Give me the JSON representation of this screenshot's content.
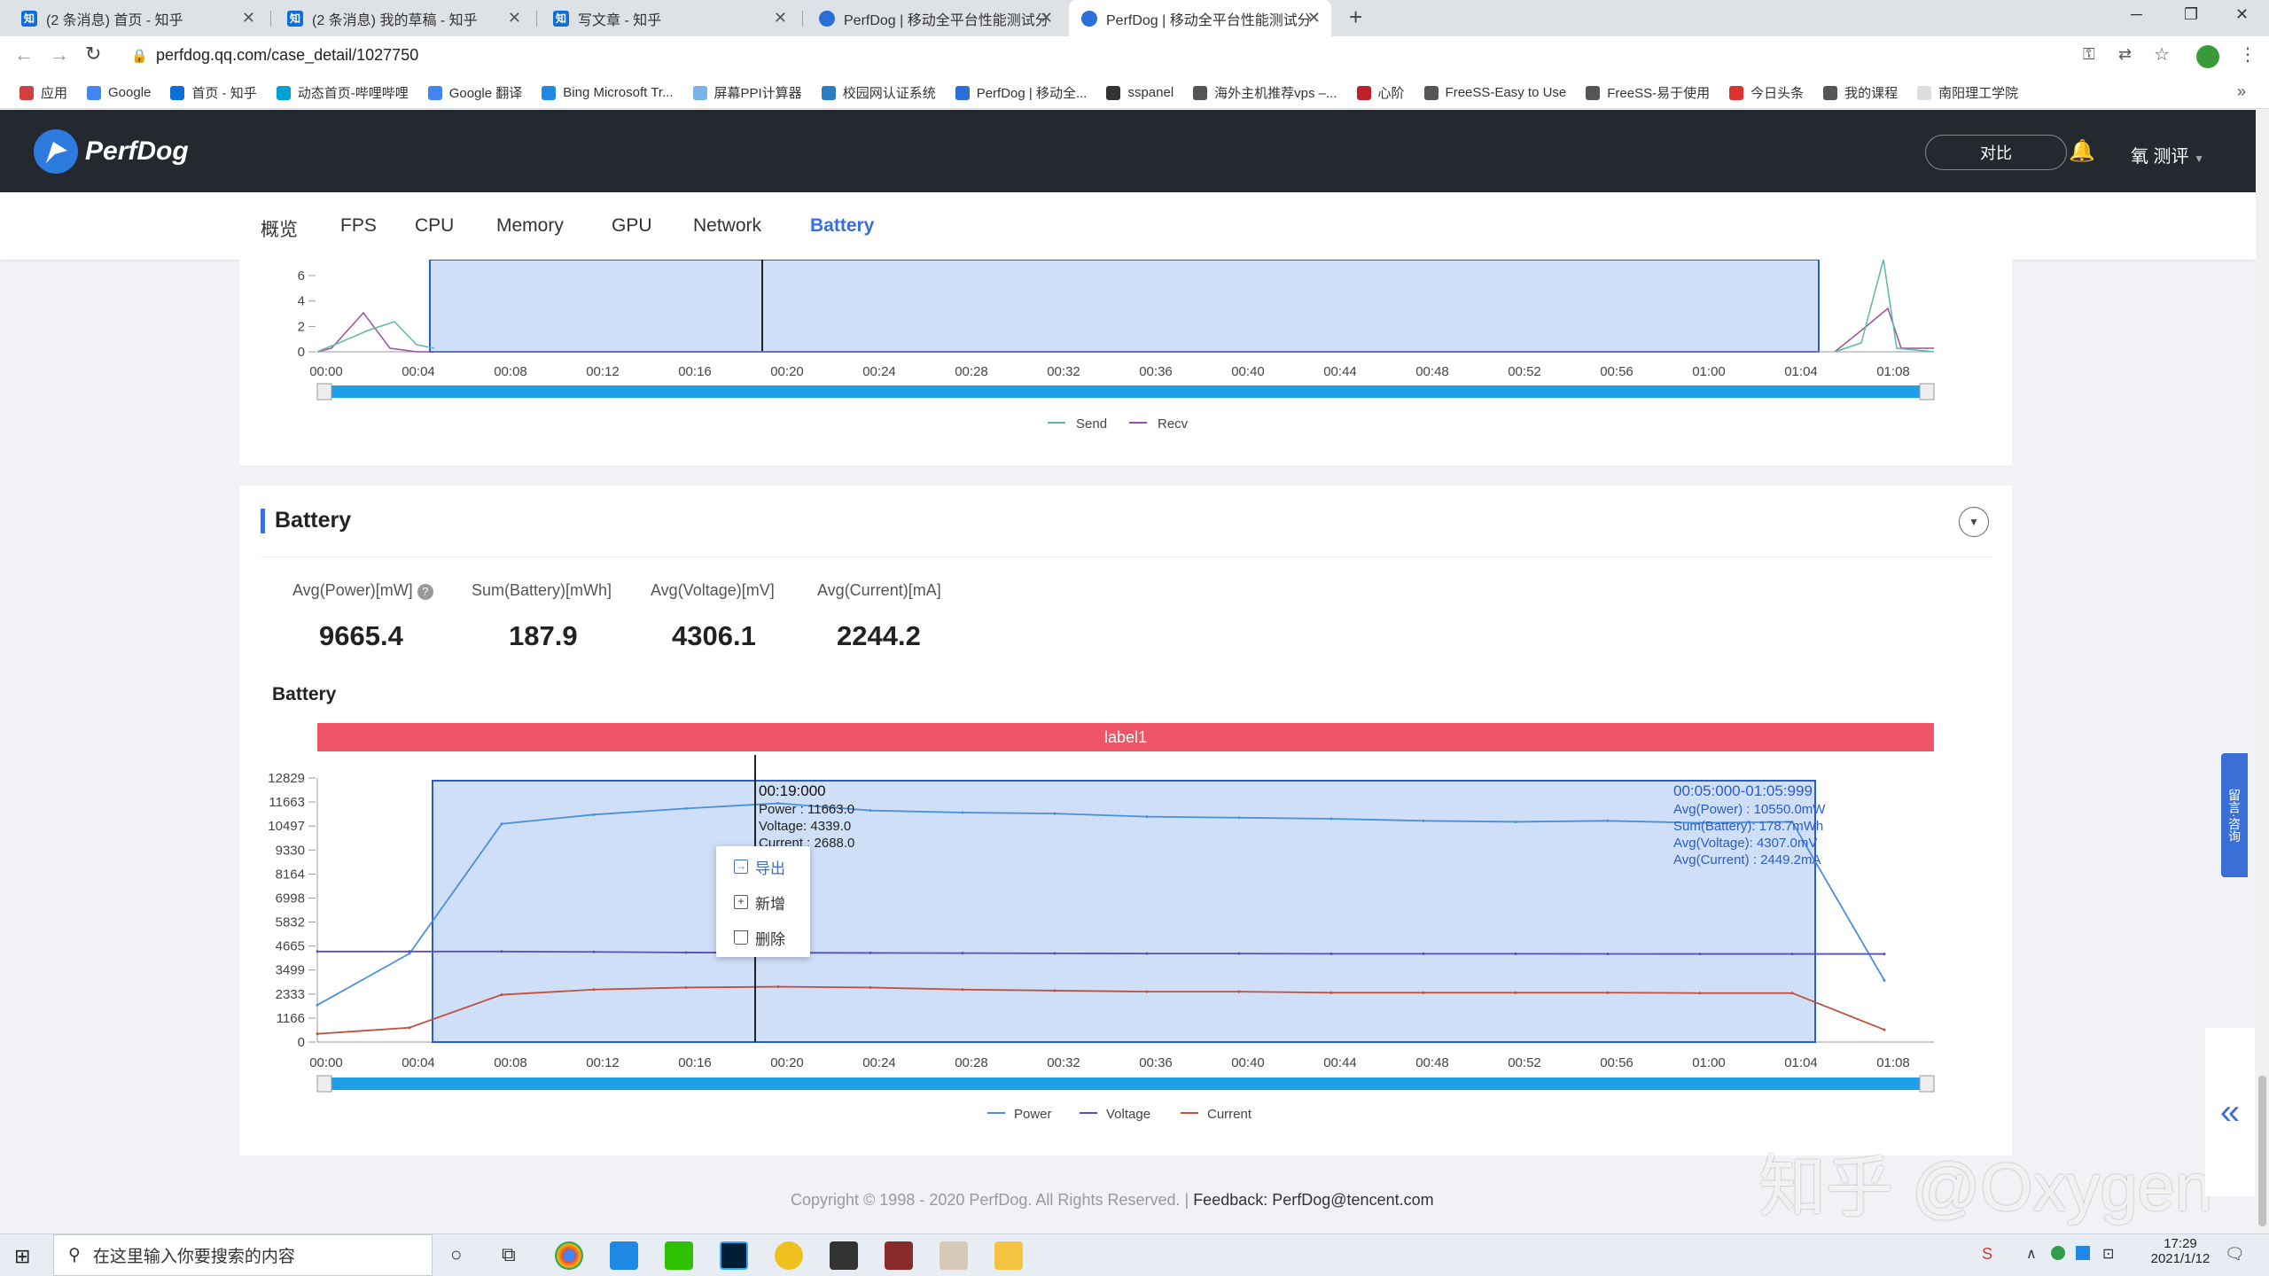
{
  "browser": {
    "tabs": [
      {
        "label": "(2 条消息) 首页 - 知乎",
        "icon": "zhihu-icon",
        "glyph": "知"
      },
      {
        "label": "(2 条消息) 我的草稿 - 知乎",
        "icon": "zhihu-icon",
        "glyph": "知"
      },
      {
        "label": "写文章 - 知乎",
        "icon": "zhihu-icon",
        "glyph": "知"
      },
      {
        "label": "PerfDog | 移动全平台性能测试分",
        "icon": "perfdog-icon",
        "glyph": ""
      },
      {
        "label": "PerfDog | 移动全平台性能测试分",
        "icon": "perfdog-icon",
        "glyph": ""
      }
    ],
    "new_tab": "+",
    "url": "perfdog.qq.com/case_detail/1027750",
    "bookmarks": [
      {
        "label": "应用",
        "color": "#d04040"
      },
      {
        "label": "Google",
        "color": "#4285f4"
      },
      {
        "label": "首页 - 知乎",
        "color": "#0f6fd8"
      },
      {
        "label": "动态首页-哔哩哔哩",
        "color": "#00a1d6"
      },
      {
        "label": "Google 翻译",
        "color": "#4285f4"
      },
      {
        "label": "Bing Microsoft Tr...",
        "color": "#1e88e5"
      },
      {
        "label": "屏幕PPI计算器",
        "color": "#7ab3e6"
      },
      {
        "label": "校园网认证系统",
        "color": "#2b7dc2"
      },
      {
        "label": "PerfDog | 移动全...",
        "color": "#2a6fd6"
      },
      {
        "label": "sspanel",
        "color": "#333333"
      },
      {
        "label": "海外主机推荐vps –...",
        "color": "#555555"
      },
      {
        "label": "心阶",
        "color": "#c0202a"
      },
      {
        "label": "FreeSS-Easy to Use",
        "color": "#555555"
      },
      {
        "label": "FreeSS-易于使用",
        "color": "#555555"
      },
      {
        "label": "今日头条",
        "color": "#e03030"
      },
      {
        "label": "我的课程",
        "color": "#555555"
      },
      {
        "label": "南阳理工学院",
        "color": "#dddddd"
      }
    ]
  },
  "app": {
    "logo": "PerfDog",
    "compare_button": "对比",
    "user": "氧 测评",
    "nav": [
      "概览",
      "FPS",
      "CPU",
      "Memory",
      "GPU",
      "Network",
      "Battery"
    ],
    "active_nav": "Battery"
  },
  "network_chart": {
    "y_ticks": [
      "6",
      "4",
      "2",
      "0"
    ],
    "x_ticks": [
      "00:00",
      "00:04",
      "00:08",
      "00:12",
      "00:16",
      "00:20",
      "00:24",
      "00:28",
      "00:32",
      "00:36",
      "00:40",
      "00:44",
      "00:48",
      "00:52",
      "00:56",
      "01:00",
      "01:04",
      "01:08"
    ],
    "legend": [
      {
        "name": "Send",
        "color": "#5fb8a6"
      },
      {
        "name": "Recv",
        "color": "#9c4f9c"
      }
    ]
  },
  "battery": {
    "section_title": "Battery",
    "metrics": [
      {
        "label": "Avg(Power)[mW]",
        "value": "9665.4"
      },
      {
        "label": "Sum(Battery)[mWh]",
        "value": "187.9"
      },
      {
        "label": "Avg(Voltage)[mV]",
        "value": "4306.1"
      },
      {
        "label": "Avg(Current)[mA]",
        "value": "2244.2"
      }
    ],
    "chart_title": "Battery",
    "label_bar": "label1",
    "cursor_tooltip": {
      "time": "00:19:000",
      "lines": [
        "Power   : 11663.0",
        "Voltage: 4339.0",
        "Current : 2688.0"
      ]
    },
    "range_tooltip": {
      "time": "00:05:000-01:05:999",
      "lines": [
        "Avg(Power)   : 10550.0mW",
        "Sum(Battery): 178.7mWh",
        "Avg(Voltage): 4307.0mV",
        "Avg(Current) : 2449.2mA"
      ]
    },
    "context_menu": [
      "导出",
      "新增",
      "删除"
    ],
    "legend": [
      {
        "name": "Power",
        "color": "#4a90d9"
      },
      {
        "name": "Voltage",
        "color": "#5a4fb8"
      },
      {
        "name": "Current",
        "color": "#c0503a"
      }
    ]
  },
  "chart_data": {
    "type": "line",
    "title": "Battery",
    "x": [
      "00:00",
      "00:04",
      "00:08",
      "00:12",
      "00:16",
      "00:20",
      "00:24",
      "00:28",
      "00:32",
      "00:36",
      "00:40",
      "00:44",
      "00:48",
      "00:52",
      "00:56",
      "01:00",
      "01:04",
      "01:08"
    ],
    "y_ticks": [
      0,
      1166,
      2333,
      3499,
      4665,
      5832,
      6998,
      8164,
      9330,
      10497,
      11663,
      12829
    ],
    "ylim": [
      0,
      12829
    ],
    "series": [
      {
        "name": "Power",
        "values": [
          1800,
          4300,
          10600,
          11050,
          11350,
          11600,
          11250,
          11150,
          11100,
          10950,
          10900,
          10850,
          10750,
          10700,
          10750,
          10650,
          10700,
          3000
        ]
      },
      {
        "name": "Voltage",
        "values": [
          4400,
          4400,
          4400,
          4380,
          4350,
          4340,
          4330,
          4320,
          4310,
          4300,
          4300,
          4290,
          4290,
          4290,
          4285,
          4280,
          4280,
          4280
        ]
      },
      {
        "name": "Current",
        "values": [
          400,
          700,
          2300,
          2550,
          2650,
          2688,
          2650,
          2550,
          2500,
          2450,
          2450,
          2400,
          2400,
          2400,
          2400,
          2380,
          2380,
          600
        ]
      }
    ],
    "selection": [
      "00:05",
      "01:05"
    ],
    "cursor": "00:19"
  },
  "footer": {
    "copyright": "Copyright © 1998 - 2020 PerfDog. All Rights Reserved. |",
    "feedback": "Feedback: PerfDog@tencent.com"
  },
  "watermark": "知乎 @Oxygen",
  "taskbar": {
    "search_placeholder": "在这里输入你要搜索的内容",
    "time": "17:29",
    "date": "2021/1/12"
  }
}
